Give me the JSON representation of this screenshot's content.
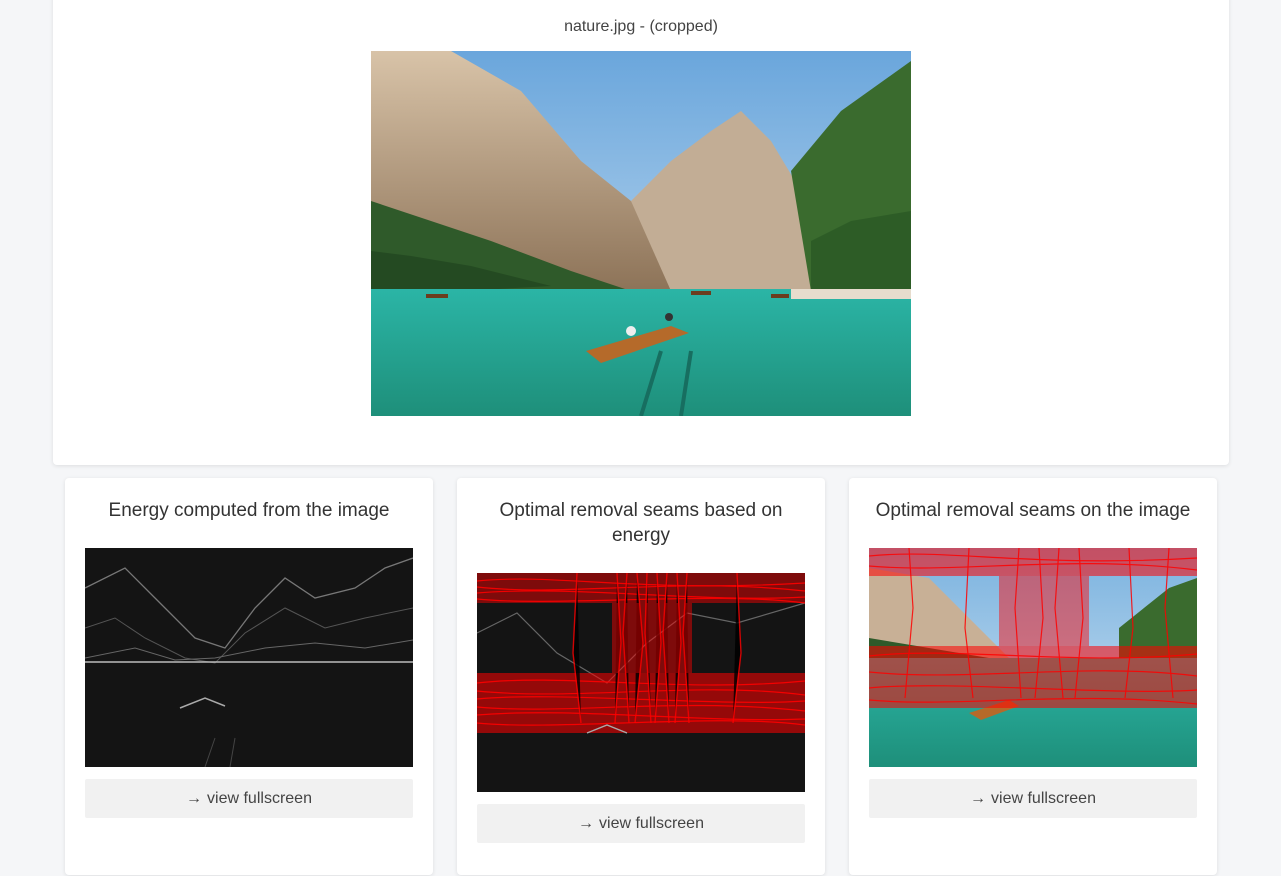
{
  "main_image": {
    "title": "nature.jpg - (cropped)"
  },
  "cards": [
    {
      "title": "Energy computed from the image",
      "button_label": "view fullscreen",
      "button_icon": "arrow-right-icon"
    },
    {
      "title": "Optimal removal seams based on energy",
      "button_label": "view fullscreen",
      "button_icon": "arrow-right-icon"
    },
    {
      "title": "Optimal removal seams on the image",
      "button_label": "view fullscreen",
      "button_icon": "arrow-right-icon"
    }
  ],
  "colors": {
    "seam": "#ff0000",
    "water": "#2fa79a",
    "sky": "#9fc8e6",
    "rock": "#b79a7a",
    "forest": "#2f5a2a",
    "energy_bg": "#141414"
  }
}
